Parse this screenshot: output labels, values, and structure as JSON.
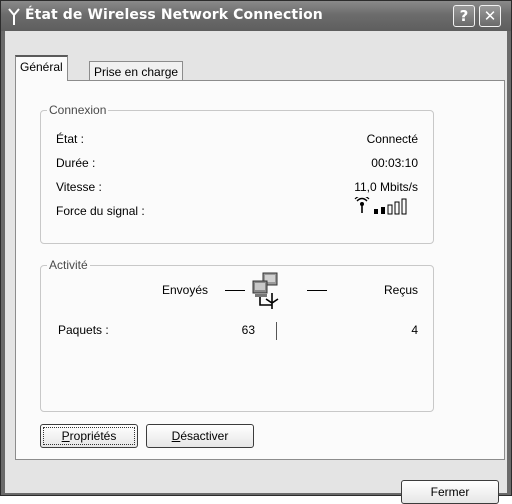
{
  "window": {
    "title": "État de Wireless Network Connection",
    "help_glyph": "?",
    "close_glyph": "✕"
  },
  "tabs": [
    {
      "label": "Général",
      "active": true
    },
    {
      "label": "Prise en charge",
      "active": false
    }
  ],
  "connection": {
    "group_label": "Connexion",
    "rows": [
      {
        "label": "État :",
        "value": "Connecté"
      },
      {
        "label": "Durée :",
        "value": "00:03:10"
      },
      {
        "label": "Vitesse :",
        "value": "11,0 Mbits/s"
      },
      {
        "label": "Force du signal :",
        "value": ""
      }
    ],
    "signal_bars_filled": 2,
    "signal_bars_total": 5
  },
  "activity": {
    "group_label": "Activité",
    "sent_label": "Envoyés",
    "received_label": "Reçus",
    "packets_label": "Paquets :",
    "packets_sent": "63",
    "packets_received": "4"
  },
  "buttons": {
    "properties_prefix": "P",
    "properties_rest": "ropriétés",
    "disable_prefix": "D",
    "disable_rest": "ésactiver",
    "close": "Fermer"
  },
  "icons": {
    "title": "antenna-icon",
    "signal": "wireless-signal-icon",
    "activity": "network-computers-icon"
  }
}
